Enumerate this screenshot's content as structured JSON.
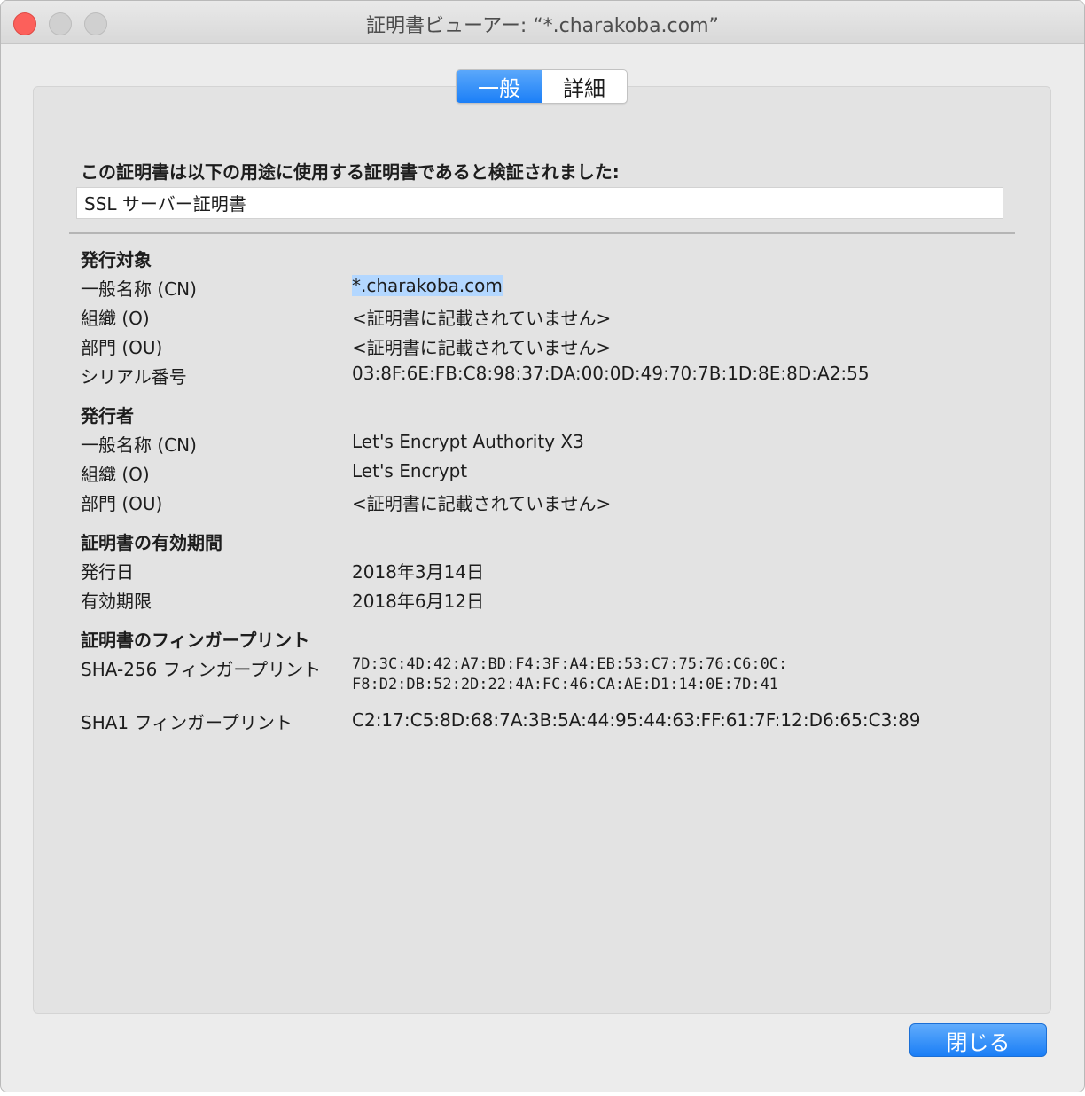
{
  "window": {
    "title": "証明書ビューアー: “*.charakoba.com”"
  },
  "tabs": [
    {
      "label": "一般",
      "active": true
    },
    {
      "label": "詳細",
      "active": false
    }
  ],
  "verified_label": "この証明書は以下の用途に使用する証明書であると検証されました:",
  "usage_value": "SSL サーバー証明書",
  "subject": {
    "title": "発行対象",
    "rows": [
      {
        "label": "一般名称 (CN)",
        "value": "*.charakoba.com"
      },
      {
        "label": "組織 (O)",
        "value": "<証明書に記載されていません>"
      },
      {
        "label": "部門 (OU)",
        "value": "<証明書に記載されていません>"
      },
      {
        "label": "シリアル番号",
        "value": "03:8F:6E:FB:C8:98:37:DA:00:0D:49:70:7B:1D:8E:8D:A2:55"
      }
    ]
  },
  "issuer": {
    "title": "発行者",
    "rows": [
      {
        "label": "一般名称 (CN)",
        "value": "Let's Encrypt Authority X3"
      },
      {
        "label": "組織 (O)",
        "value": "Let's Encrypt"
      },
      {
        "label": "部門 (OU)",
        "value": "<証明書に記載されていません>"
      }
    ]
  },
  "validity": {
    "title": "証明書の有効期間",
    "rows": [
      {
        "label": "発行日",
        "value": "2018年3月14日"
      },
      {
        "label": "有効期限",
        "value": "2018年6月12日"
      }
    ]
  },
  "fingerprints": {
    "title": "証明書のフィンガープリント",
    "sha256_label": "SHA-256 フィンガープリント",
    "sha256_line1": "7D:3C:4D:42:A7:BD:F4:3F:A4:EB:53:C7:75:76:C6:0C:",
    "sha256_line2": "F8:D2:DB:52:2D:22:4A:FC:46:CA:AE:D1:14:0E:7D:41",
    "sha1_label": "SHA1 フィンガープリント",
    "sha1_value": "C2:17:C5:8D:68:7A:3B:5A:44:95:44:63:FF:61:7F:12:D6:65:C3:89"
  },
  "buttons": {
    "close_label": "閉じる"
  },
  "colors": {
    "accent": "#1b7ff7",
    "close_traffic": "#fc605b",
    "selection": "#b3d7ff"
  }
}
